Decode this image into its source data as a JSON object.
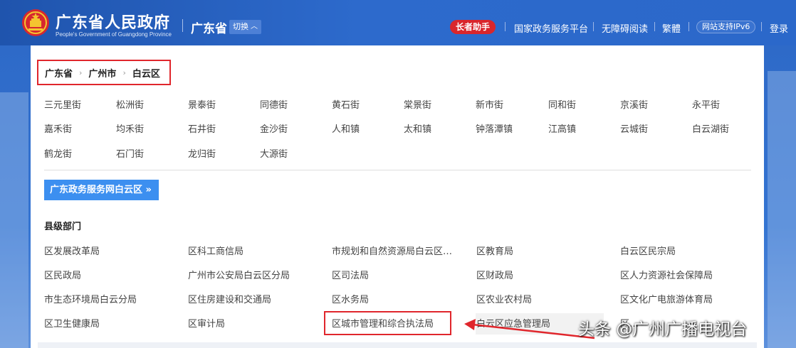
{
  "header": {
    "site_title": "广东省人民政府",
    "site_subtitle": "People's Government of Guangdong Province",
    "region": "广东省",
    "switch_label": "切换",
    "elder_helper": "长者助手",
    "nav": [
      "国家政务服务平台",
      "无障碍阅读",
      "繁體",
      "网站支持IPv6",
      "登录"
    ]
  },
  "breadcrumb": [
    "广东省",
    "广州市",
    "白云区"
  ],
  "streets": [
    [
      "三元里街",
      "松洲街",
      "景泰街",
      "同德街",
      "黄石街",
      "棠景街",
      "新市街",
      "同和街",
      "京溪街",
      "永平街"
    ],
    [
      "嘉禾街",
      "均禾街",
      "石井街",
      "金沙街",
      "人和镇",
      "太和镇",
      "钟落潭镇",
      "江高镇",
      "云城街",
      "白云湖街"
    ],
    [
      "鹤龙街",
      "石门街",
      "龙归街",
      "大源街"
    ]
  ],
  "portal_button": "广东政务服务网白云区",
  "section_title": "县级部门",
  "departments": [
    [
      "区发展改革局",
      "区科工商信局",
      "市规划和自然资源局白云区…",
      "区教育局",
      "白云区民宗局"
    ],
    [
      "区民政局",
      "广州市公安局白云区分局",
      "区司法局",
      "区财政局",
      "区人力资源社会保障局"
    ],
    [
      "市生态环境局白云分局",
      "区住房建设和交通局",
      "区水务局",
      "区农业农村局",
      "区文化广电旅游体育局"
    ],
    [
      "区卫生健康局",
      "区审计局",
      "区城市管理和综合执法局",
      "白云区应急管理局",
      "区…"
    ]
  ],
  "watermark": "头条 @广州广播电视台",
  "colors": {
    "header_blue": "#2b68ca",
    "highlight_red": "#e0262c",
    "portal_blue": "#3c8ff0",
    "elder_red": "#d9262c"
  }
}
